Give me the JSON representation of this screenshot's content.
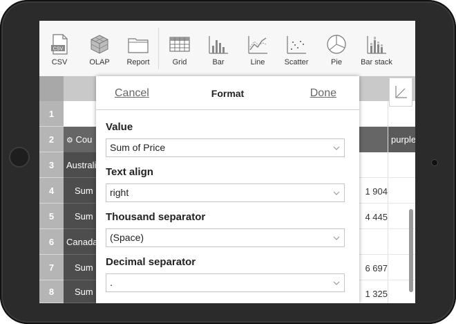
{
  "toolbar": {
    "items": [
      {
        "label": "CSV",
        "icon": "csv-file-icon"
      },
      {
        "label": "OLAP",
        "icon": "olap-cube-icon"
      },
      {
        "label": "Report",
        "icon": "report-folder-icon"
      },
      {
        "label": "Grid",
        "icon": "grid-icon"
      },
      {
        "label": "Bar",
        "icon": "bar-chart-icon"
      },
      {
        "label": "Line",
        "icon": "line-chart-icon"
      },
      {
        "label": "Scatter",
        "icon": "scatter-chart-icon"
      },
      {
        "label": "Pie",
        "icon": "pie-chart-icon"
      },
      {
        "label": "Bar stack",
        "icon": "bar-stack-icon"
      }
    ],
    "csv_badge": "CSV"
  },
  "grid": {
    "row_numbers": [
      "1",
      "2",
      "3",
      "4",
      "5",
      "6",
      "7",
      "8"
    ],
    "row2_label": "Cou",
    "row2_right": "purple",
    "row3_label": "Australia",
    "row4_label": "Sum",
    "row5_label": "Sum",
    "row6_label": "Canada",
    "row7_label": "Sum",
    "row8_label": "Sum",
    "values": [
      "1 904",
      "4 445",
      "6 697",
      "1 325"
    ]
  },
  "format_dialog": {
    "cancel": "Cancel",
    "title": "Format",
    "done": "Done",
    "fields": [
      {
        "label": "Value",
        "value": "Sum of Price"
      },
      {
        "label": "Text align",
        "value": "right"
      },
      {
        "label": "Thousand separator",
        "value": "(Space)"
      },
      {
        "label": "Decimal separator",
        "value": "."
      }
    ]
  },
  "colors": {
    "bezel": "#2b2b2b",
    "row_header": "#b5b5b5",
    "dark_cell": "#4d4d4d",
    "mid_cell": "#666666",
    "toolbar_bg": "#f7f7f7"
  }
}
